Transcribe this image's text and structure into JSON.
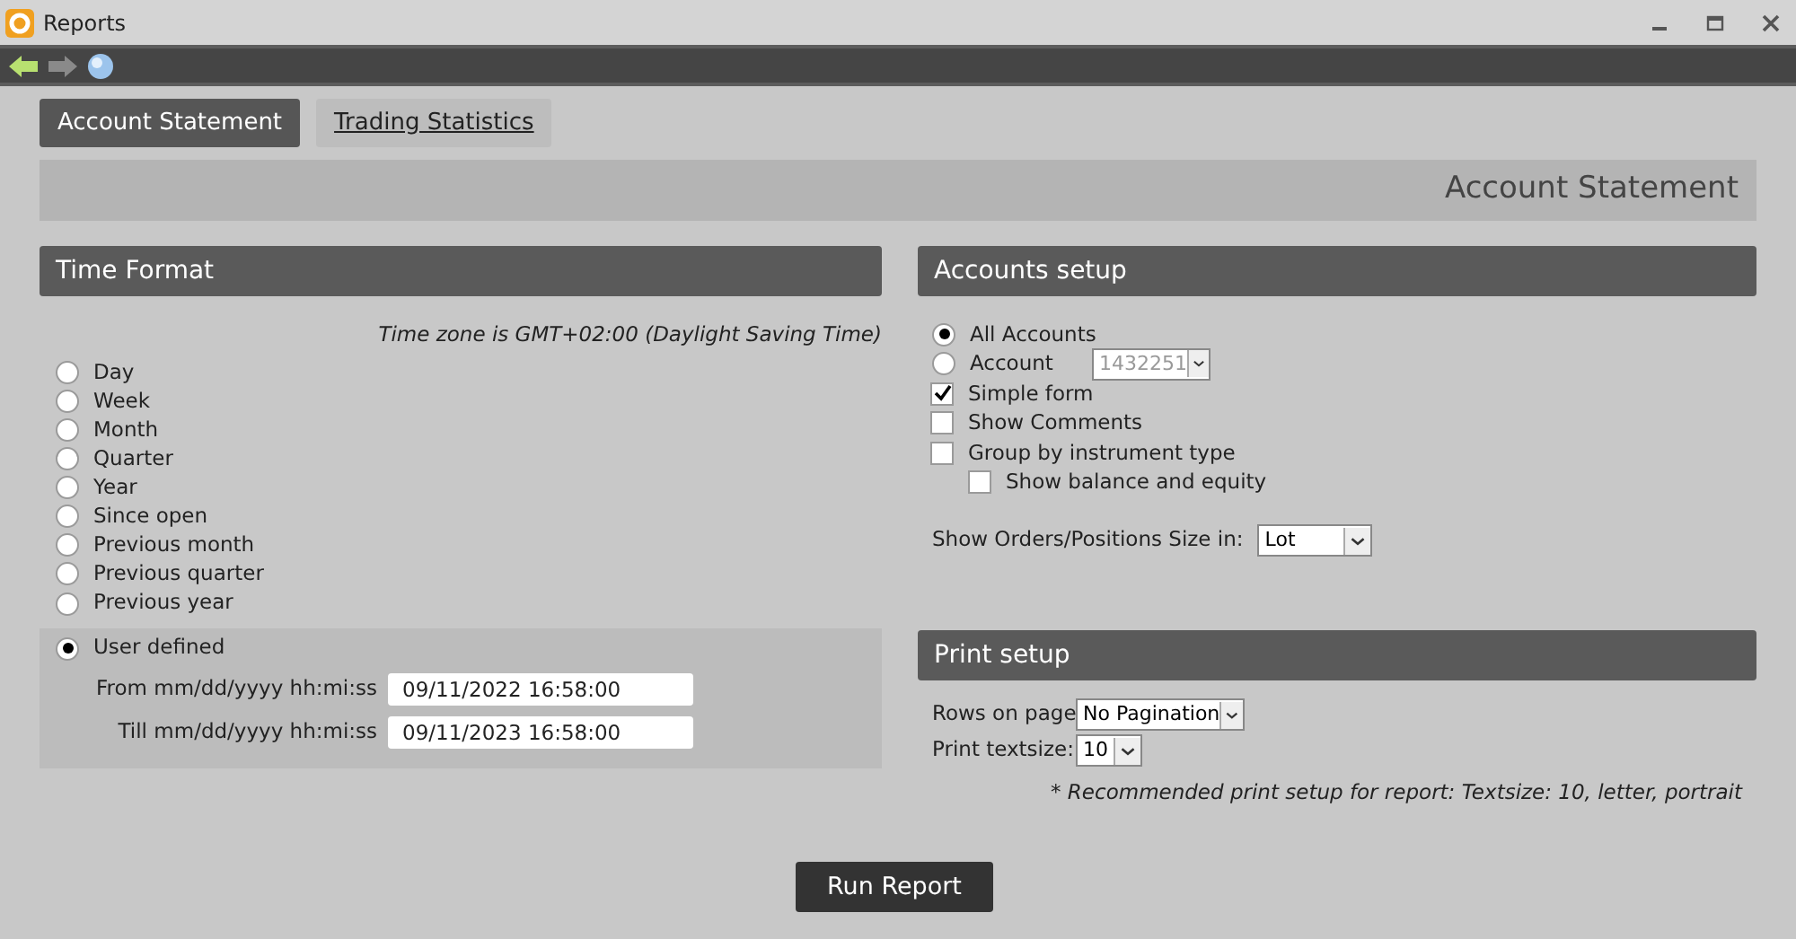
{
  "window": {
    "title": "Reports"
  },
  "tabs": [
    {
      "label": "Account Statement",
      "selected": true
    },
    {
      "label": "Trading Statistics",
      "selected": false
    }
  ],
  "page_heading": "Account Statement",
  "time_format": {
    "title": "Time Format",
    "timezone_note": "Time zone is GMT+02:00 (Daylight Saving Time)",
    "options": [
      {
        "label": "Day",
        "selected": false
      },
      {
        "label": "Week",
        "selected": false
      },
      {
        "label": "Month",
        "selected": false
      },
      {
        "label": "Quarter",
        "selected": false
      },
      {
        "label": "Year",
        "selected": false
      },
      {
        "label": "Since open",
        "selected": false
      },
      {
        "label": "Previous month",
        "selected": false
      },
      {
        "label": "Previous quarter",
        "selected": false
      },
      {
        "label": "Previous year",
        "selected": false
      }
    ],
    "user_defined": {
      "label": "User defined",
      "selected": true
    },
    "from": {
      "label": "From mm/dd/yyyy hh:mi:ss",
      "value": "09/11/2022 16:58:00"
    },
    "till": {
      "label": "Till mm/dd/yyyy hh:mi:ss",
      "value": "09/11/2023 16:58:00"
    }
  },
  "accounts_setup": {
    "title": "Accounts setup",
    "scope": [
      {
        "label": "All Accounts",
        "selected": true
      },
      {
        "label": "Account",
        "selected": false
      }
    ],
    "account_select": {
      "value": "1432251",
      "disabled": true
    },
    "checkboxes": [
      {
        "label": "Simple form",
        "checked": true
      },
      {
        "label": "Show Comments",
        "checked": false
      },
      {
        "label": "Group by instrument type",
        "checked": false,
        "children": [
          {
            "label": "Show balance and equity",
            "checked": false
          }
        ]
      }
    ],
    "size_select": {
      "label": "Show Orders/Positions Size in:",
      "value": "Lot"
    }
  },
  "print_setup": {
    "title": "Print setup",
    "rows": {
      "label": "Rows on page",
      "value": "No Pagination"
    },
    "textsize": {
      "label": "Print textsize:",
      "value": "10"
    },
    "note": "* Recommended print setup for report: Textsize: 10, letter, portrait"
  },
  "run_button": "Run Report"
}
